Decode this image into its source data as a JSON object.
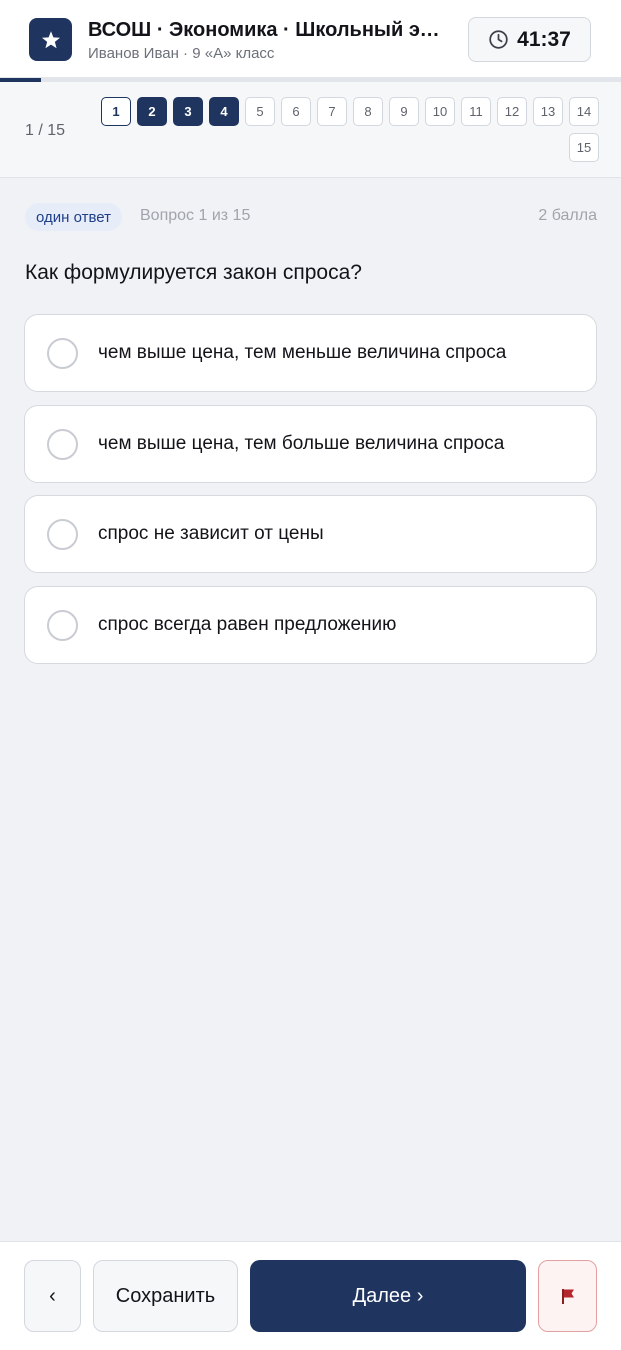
{
  "header": {
    "title": "ВСОШ · Экономика · Школьный этап",
    "subtitle": "Иванов Иван · 9 «А» класс",
    "logo_icon": "star-icon",
    "timer": "41:37",
    "timer_icon": "clock-icon",
    "progress_fraction": 0.0667
  },
  "nav": {
    "counter": "1 / 15",
    "questions": [
      {
        "label": "1",
        "state": "current"
      },
      {
        "label": "2",
        "state": "answered"
      },
      {
        "label": "3",
        "state": "answered"
      },
      {
        "label": "4",
        "state": "answered"
      },
      {
        "label": "5",
        "state": "empty"
      },
      {
        "label": "6",
        "state": "empty"
      },
      {
        "label": "7",
        "state": "empty"
      },
      {
        "label": "8",
        "state": "empty"
      },
      {
        "label": "9",
        "state": "empty"
      },
      {
        "label": "10",
        "state": "empty"
      },
      {
        "label": "11",
        "state": "empty"
      },
      {
        "label": "12",
        "state": "empty"
      },
      {
        "label": "13",
        "state": "empty"
      },
      {
        "label": "14",
        "state": "empty"
      },
      {
        "label": "15",
        "state": "empty"
      }
    ]
  },
  "question": {
    "type_badge": "один ответ",
    "number": "Вопрос 1 из 15",
    "points": "2 балла",
    "text": "Как формулируется закон спроса?",
    "options": [
      {
        "label": "чем выше цена, тем меньше величина спроса",
        "selected": false
      },
      {
        "label": "чем выше цена, тем больше величина спроса",
        "selected": false
      },
      {
        "label": "спрос не зависит от цены",
        "selected": false
      },
      {
        "label": "спрос всегда равен предложению",
        "selected": false
      }
    ]
  },
  "footer": {
    "prev_label": "‹",
    "save_label": "Сохранить",
    "next_label": "Далее ›",
    "flag_icon": "flag-icon"
  },
  "colors": {
    "brand": "#1f3560",
    "badge_bg": "#e6edf9",
    "badge_text": "#1f3f8a",
    "flag_red": "#b3262d"
  }
}
